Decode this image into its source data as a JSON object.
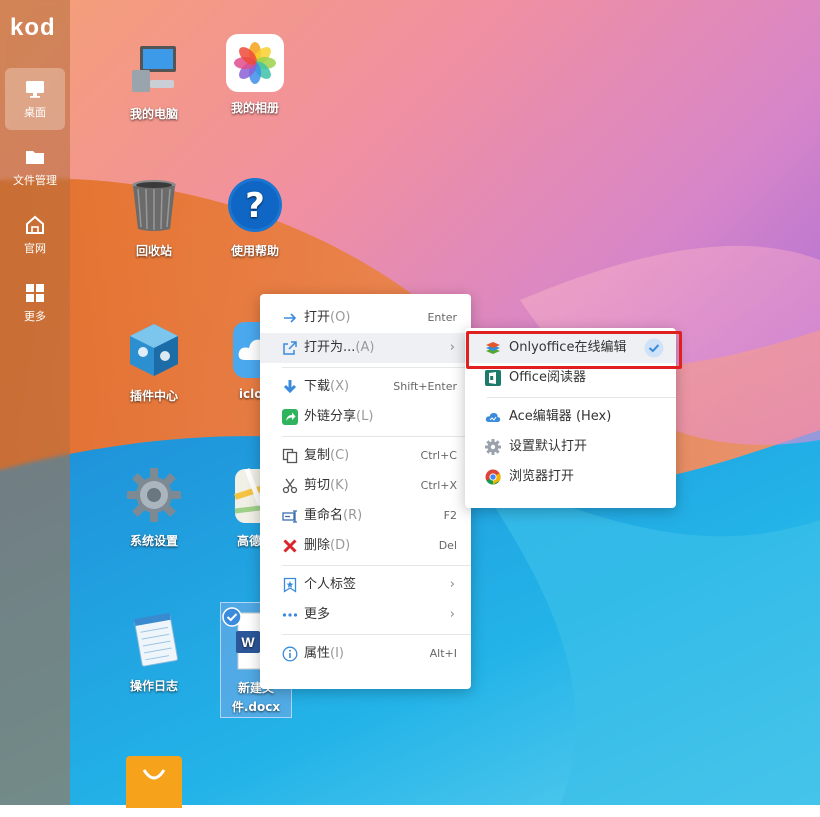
{
  "sidebar": {
    "logo": "kod",
    "items": [
      {
        "label": "桌面",
        "icon": "monitor-icon",
        "active": true
      },
      {
        "label": "文件管理",
        "icon": "folder-icon"
      },
      {
        "label": "官网",
        "icon": "home-icon"
      },
      {
        "label": "更多",
        "icon": "grid-icon"
      }
    ]
  },
  "desktop": {
    "icons": [
      {
        "label": "我的电脑",
        "icon": "computer-icon"
      },
      {
        "label": "我的相册",
        "icon": "photos-icon"
      },
      {
        "label": "回收站",
        "icon": "trash-icon"
      },
      {
        "label": "使用帮助",
        "icon": "help-icon"
      },
      {
        "label": "插件中心",
        "icon": "plugin-icon"
      },
      {
        "label": "iclou",
        "icon": "icloud-icon"
      },
      {
        "label": "系统设置",
        "icon": "settings-icon"
      },
      {
        "label": "高德地",
        "icon": "map-icon"
      },
      {
        "label": "操作日志",
        "icon": "notepad-icon"
      },
      {
        "label": "新建文件.docx",
        "label_line1": "新建文",
        "label_line2": "件.docx",
        "icon": "word-doc-icon",
        "selected": true
      },
      {
        "label": "",
        "icon": "shopping-bag-icon"
      }
    ]
  },
  "context_menu": {
    "items": [
      {
        "label": "打开",
        "key": "(O)",
        "shortcut": "Enter",
        "icon": "arrow-right-icon"
      },
      {
        "label": "打开为...",
        "key": "(A)",
        "has_submenu": true,
        "icon": "open-external-icon",
        "hover": true
      },
      {
        "label": "下载",
        "key": "(X)",
        "shortcut": "Shift+Enter",
        "icon": "download-icon"
      },
      {
        "label": "外链分享",
        "key": "(L)",
        "icon": "share-icon"
      },
      {
        "label": "复制",
        "key": "(C)",
        "shortcut": "Ctrl+C",
        "icon": "copy-icon"
      },
      {
        "label": "剪切",
        "key": "(K)",
        "shortcut": "Ctrl+X",
        "icon": "scissors-icon"
      },
      {
        "label": "重命名",
        "key": "(R)",
        "shortcut": "F2",
        "icon": "rename-icon"
      },
      {
        "label": "删除",
        "key": "(D)",
        "shortcut": "Del",
        "icon": "delete-icon"
      },
      {
        "label": "个人标签",
        "has_submenu": true,
        "icon": "bookmark-icon"
      },
      {
        "label": "更多",
        "has_submenu": true,
        "icon": "more-icon"
      },
      {
        "label": "属性",
        "key": "(I)",
        "shortcut": "Alt+I",
        "icon": "info-icon"
      }
    ]
  },
  "open_with_submenu": {
    "items": [
      {
        "label": "Onlyoffice在线编辑",
        "icon": "onlyoffice-icon",
        "checked": true
      },
      {
        "label": "Office阅读器",
        "icon": "office-icon"
      },
      {
        "label": "Ace编辑器 (Hex)",
        "icon": "cloud-icon"
      },
      {
        "label": "设置默认打开",
        "icon": "gear-icon"
      },
      {
        "label": "浏览器打开",
        "icon": "chrome-icon"
      }
    ]
  },
  "colors": {
    "accent": "#3b8bdc",
    "highlight": "#e02020",
    "delete": "#d9252b",
    "share": "#2fb35c"
  }
}
